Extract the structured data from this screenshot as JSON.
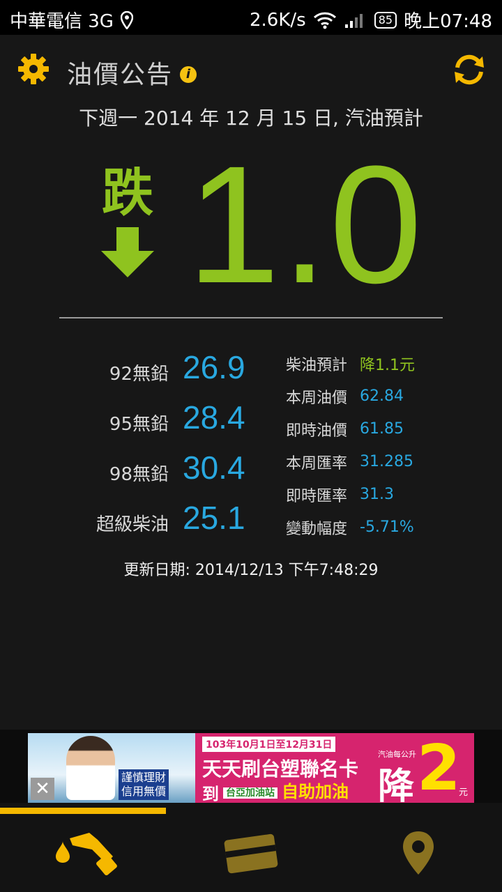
{
  "status_bar": {
    "carrier": "中華電信 3G",
    "speed": "2.6K/s",
    "battery": "85",
    "time": "晚上07:48"
  },
  "header": {
    "title": "油價公告",
    "info_icon": "i"
  },
  "forecast_text": "下週一 2014 年 12 月 15 日, 汽油預計",
  "trend": {
    "label": "跌",
    "value": "1.0",
    "color": "#8fc31f"
  },
  "prices": [
    {
      "name": "92無鉛",
      "value": "26.9"
    },
    {
      "name": "95無鉛",
      "value": "28.4"
    },
    {
      "name": "98無鉛",
      "value": "30.4"
    },
    {
      "name": "超級柴油",
      "value": "25.1"
    }
  ],
  "details": [
    {
      "label": "柴油預計",
      "value": "降1.1元"
    },
    {
      "label": "本周油價",
      "value": "62.84"
    },
    {
      "label": "即時油價",
      "value": "61.85"
    },
    {
      "label": "本周匯率",
      "value": "31.285"
    },
    {
      "label": "即時匯率",
      "value": "31.3"
    },
    {
      "label": "變動幅度",
      "value": "-5.71%"
    }
  ],
  "updated": "更新日期: 2014/12/13 下午7:48:29",
  "ad": {
    "close": "✕",
    "slogan_line1": "謹慎理財",
    "slogan_line2": "信用無價",
    "date": "103年10月1日至12月31日",
    "headline": "天天刷台塑聯名卡",
    "sub_prefix": "到",
    "station": "台亞加油站",
    "sub_suffix": "自助加油",
    "tag": "汽油每公升",
    "drop": "降",
    "amount": "2",
    "unit": "元"
  },
  "colors": {
    "accent": "#f5b800",
    "up_down_green": "#8fc31f",
    "value_blue": "#29a8e0"
  },
  "tabs": [
    {
      "name": "fuel-pump-icon"
    },
    {
      "name": "credit-card-icon"
    },
    {
      "name": "map-pin-icon"
    }
  ]
}
